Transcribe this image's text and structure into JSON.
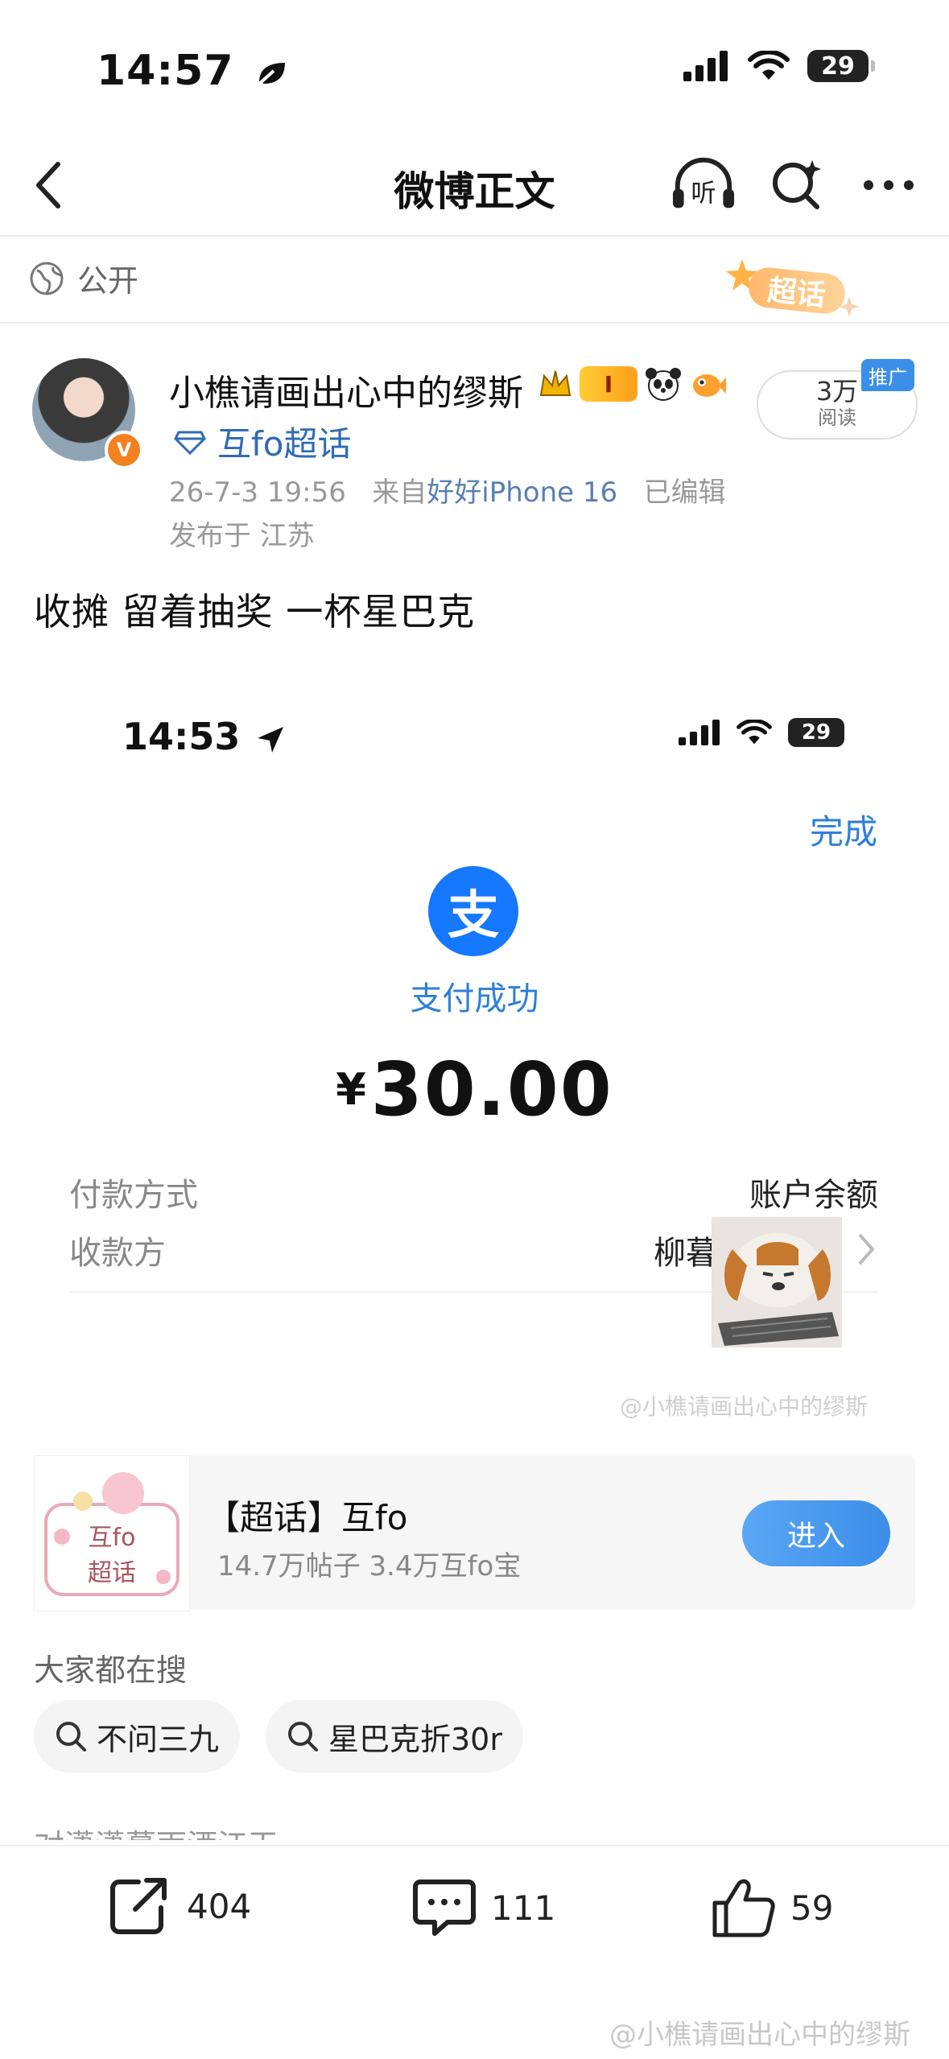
{
  "status_bar": {
    "time": "14:57",
    "battery": "29"
  },
  "nav": {
    "title": "微博正文"
  },
  "visibility": {
    "label": "公开",
    "badge": "超话"
  },
  "author": {
    "name": "小樵请画出心中的缪斯",
    "badge_level": "I",
    "topic": "互fo超话",
    "timestamp": "26-7-3 19:56",
    "source_prefix": "来自",
    "source": "好好iPhone 16",
    "edited": "已编辑",
    "location": "发布于 江苏",
    "reads_value": "3万",
    "reads_label": "阅读",
    "promo_tag": "推广"
  },
  "post": {
    "text": "收摊 留着抽奖 一杯星巴克"
  },
  "embedded_screenshot": {
    "time": "14:53",
    "battery": "29",
    "done_label": "完成",
    "logo_char": "支",
    "status": "支付成功",
    "currency": "¥",
    "amount": "30.00",
    "rows": [
      {
        "label": "付款方式",
        "value": "账户余额"
      },
      {
        "label": "收款方",
        "value": "柳暮"
      }
    ],
    "watermark": "@小樵请画出心中的缪斯"
  },
  "super_topic": {
    "thumb_text_1": "互fo",
    "thumb_text_2": "超话",
    "title": "【超话】互fo",
    "subtitle": "14.7万帖子 3.4万互fo宝",
    "enter_label": "进入"
  },
  "search": {
    "heading": "大家都在搜",
    "chips": [
      "不问三九",
      "星巴克折30r"
    ],
    "cut_text": "对潇潇暮雨洒江天"
  },
  "actions": {
    "repost": "404",
    "comment": "111",
    "like": "59"
  },
  "bottom_watermark": "@小樵请画出心中的缪斯",
  "colors": {
    "accent_blue": "#2e7fd8",
    "alipay_blue": "#1677ff",
    "badge_orange": "#f5801f"
  }
}
